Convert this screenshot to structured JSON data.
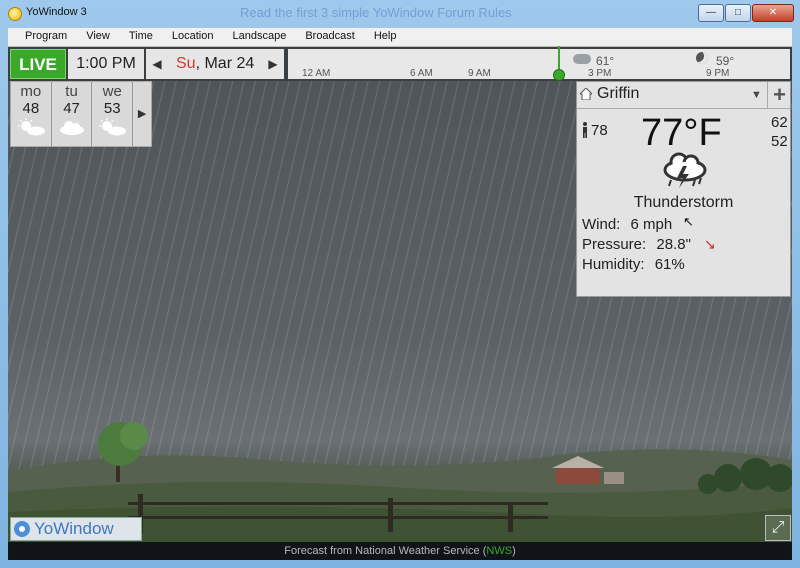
{
  "window": {
    "title": "YoWindow 3",
    "background_text": "Read the first 3 simple YoWindow Forum Rules",
    "minimize": "—",
    "maximize": "□",
    "close": "✕"
  },
  "menu": [
    "Program",
    "View",
    "Time",
    "Location",
    "Landscape",
    "Broadcast",
    "Help"
  ],
  "toolbar": {
    "live_label": "LIVE",
    "time": "1:00 PM",
    "day": "Su",
    "date": ", Mar 24",
    "prev_arrow": "◀",
    "next_arrow": "▶",
    "timeline_labels": [
      "12 AM",
      "6 AM",
      "9 AM",
      "3 PM",
      "9 PM"
    ],
    "timeline_temps": [
      "61°",
      "59°"
    ]
  },
  "forecast": {
    "days": [
      {
        "name": "mo",
        "temp": "48",
        "icon": "partly-sunny-icon"
      },
      {
        "name": "tu",
        "temp": "47",
        "icon": "cloudy-icon"
      },
      {
        "name": "we",
        "temp": "53",
        "icon": "partly-sunny-icon"
      }
    ],
    "next_arrow": "▶"
  },
  "current": {
    "location": "Griffin",
    "dropdown": "▼",
    "add": "+",
    "feels_like": "78",
    "temperature": "77°F",
    "high": "62",
    "low": "52",
    "condition": "Thunderstorm",
    "wind_label": "Wind:",
    "wind_value": "6 mph",
    "wind_arrow": "↖",
    "pressure_label": "Pressure:",
    "pressure_value": "28.8\"",
    "pressure_arrow": "↘",
    "humidity_label": "Humidity:",
    "humidity_value": "61%"
  },
  "brand": "YoWindow",
  "fullscreen": "⤢",
  "status": {
    "text": "Forecast from National Weather Service (",
    "source": "NWS",
    "close": ")"
  },
  "colors": {
    "live_green": "#3aa92a",
    "day_red": "#d23a2a",
    "pressure_red": "#d42a1f",
    "brand_blue": "#3c79c4"
  }
}
